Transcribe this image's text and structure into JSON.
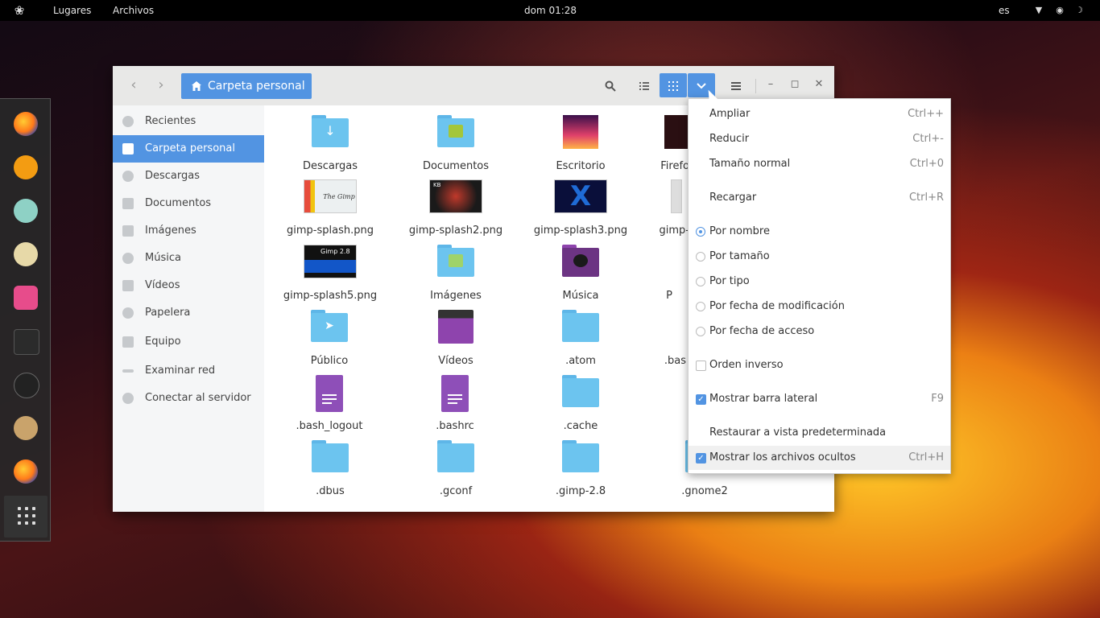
{
  "topbar": {
    "places": "Lugares",
    "files": "Archivos",
    "clock": "dom 01:28",
    "lang": "es"
  },
  "window": {
    "path": "Carpeta personal"
  },
  "sidebar": {
    "items": [
      {
        "label": "Recientes",
        "icon": "clock-icon"
      },
      {
        "label": "Carpeta personal",
        "icon": "home-icon",
        "selected": true
      },
      {
        "label": "Descargas",
        "icon": "download-icon"
      },
      {
        "label": "Documentos",
        "icon": "document-icon"
      },
      {
        "label": "Imágenes",
        "icon": "camera-icon"
      },
      {
        "label": "Música",
        "icon": "music-icon"
      },
      {
        "label": "Vídeos",
        "icon": "video-icon"
      },
      {
        "label": "Papelera",
        "icon": "trash-icon"
      },
      {
        "label": "Equipo",
        "icon": "computer-icon"
      },
      {
        "label": "Examinar red",
        "icon": "network-icon"
      },
      {
        "label": "Conectar al servidor",
        "icon": "server-icon"
      }
    ]
  },
  "files": [
    {
      "name": "Descargas"
    },
    {
      "name": "Documentos"
    },
    {
      "name": "Escritorio"
    },
    {
      "name": "Firefo"
    },
    {
      "name": "gimp-splash.png"
    },
    {
      "name": "gimp-splash2.png"
    },
    {
      "name": "gimp-splash3.png"
    },
    {
      "name": "gimp-"
    },
    {
      "name": "gimp-splash5.png"
    },
    {
      "name": "Imágenes"
    },
    {
      "name": "Música"
    },
    {
      "name": "P"
    },
    {
      "name": "Público"
    },
    {
      "name": "Vídeos"
    },
    {
      "name": ".atom"
    },
    {
      "name": ".bas"
    },
    {
      "name": ".bash_logout"
    },
    {
      "name": ".bashrc"
    },
    {
      "name": ".cache"
    },
    {
      "name": ".dbus"
    },
    {
      "name": ".gconf"
    },
    {
      "name": ".gimp-2.8"
    },
    {
      "name": ".gnome2"
    }
  ],
  "thumb_text": {
    "gimp_splash": "The Gimp",
    "gimp_splash2": "KB",
    "gimp_splash5": "Gimp 2.8"
  },
  "menu": {
    "zoom_in": {
      "label": "Ampliar",
      "accel": "Ctrl++"
    },
    "zoom_out": {
      "label": "Reducir",
      "accel": "Ctrl+-"
    },
    "normal_size": {
      "label": "Tamaño normal",
      "accel": "Ctrl+0"
    },
    "reload": {
      "label": "Recargar",
      "accel": "Ctrl+R"
    },
    "sort_name": {
      "label": "Por nombre"
    },
    "sort_size": {
      "label": "Por tamaño"
    },
    "sort_type": {
      "label": "Por tipo"
    },
    "sort_mtime": {
      "label": "Por fecha de modificación"
    },
    "sort_atime": {
      "label": "Por fecha de acceso"
    },
    "reverse": {
      "label": "Orden inverso"
    },
    "sidebar": {
      "label": "Mostrar barra lateral",
      "accel": "F9"
    },
    "restore": {
      "label": "Restaurar a vista predeterminada"
    },
    "hidden": {
      "label": "Mostrar los archivos ocultos",
      "accel": "Ctrl+H"
    }
  },
  "colors": {
    "accent": "#5294e2",
    "folder": "#6cc4ef"
  }
}
